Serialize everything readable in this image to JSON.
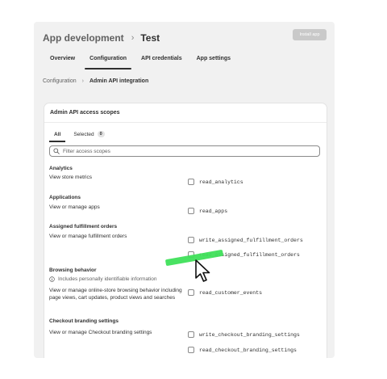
{
  "header": {
    "app": "App development",
    "separator": "›",
    "title": "Test",
    "install_label": "Install app"
  },
  "tabs": [
    {
      "label": "Overview",
      "active": false
    },
    {
      "label": "Configuration",
      "active": true
    },
    {
      "label": "API credentials",
      "active": false
    },
    {
      "label": "App settings",
      "active": false
    }
  ],
  "breadcrumb": {
    "parent": "Configuration",
    "separator": "›",
    "current": "Admin API integration"
  },
  "card": {
    "title": "Admin API access scopes",
    "filter_tabs": [
      {
        "label": "All",
        "active": true
      },
      {
        "label": "Selected",
        "count": "0",
        "active": false
      }
    ],
    "search_placeholder": "Filter access scopes"
  },
  "sections": [
    {
      "heading": "Analytics",
      "description": "View store metrics",
      "scopes": [
        "read_analytics"
      ]
    },
    {
      "heading": "Applications",
      "description": "View or manage apps",
      "scopes": [
        "read_apps"
      ]
    },
    {
      "heading": "Assigned fulfillment orders",
      "description": "View or manage fulfillment orders",
      "scopes": [
        "write_assigned_fulfillment_orders",
        "read_assigned_fulfillment_orders"
      ]
    },
    {
      "heading": "Browsing behavior",
      "note": "Includes personally identifiable information",
      "description": "View or manage online-store browsing behavior including page views, cart updates, product views and searches",
      "scopes": [
        "read_customer_events"
      ]
    },
    {
      "heading": "Checkout branding settings",
      "description": "View or manage Checkout branding settings",
      "scopes": [
        "write_checkout_branding_settings",
        "read_checkout_branding_settings"
      ]
    }
  ],
  "icons": {
    "search": "search-icon",
    "info": "info-icon",
    "cursor": "mouse-pointer-icon"
  },
  "colors": {
    "highlight": "#3fe05a",
    "text": "#303030",
    "background": "#f1f1f1"
  }
}
